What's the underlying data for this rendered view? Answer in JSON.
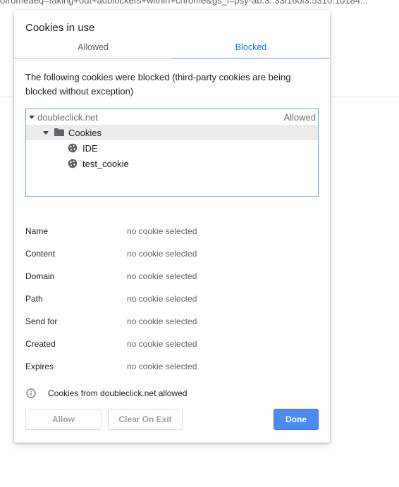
{
  "background": {
    "url_fragment": "ofromeaeq=taking+out+adblockers+within+chrome&gs_l=psy-ab.3..33i160l3.5310.10184..."
  },
  "dialog": {
    "title": "Cookies in use",
    "tabs": [
      {
        "label": "Allowed",
        "selected": false
      },
      {
        "label": "Blocked",
        "selected": true
      }
    ],
    "description": "The following cookies were blocked (third-party cookies are being blocked without exception)",
    "tree": {
      "domain": "doubleclick.net",
      "domain_status": "Allowed",
      "folder": "Cookies",
      "cookies": [
        "IDE",
        "test_cookie"
      ]
    },
    "details": [
      {
        "label": "Name",
        "value": "no cookie selected"
      },
      {
        "label": "Content",
        "value": "no cookie selected"
      },
      {
        "label": "Domain",
        "value": "no cookie selected"
      },
      {
        "label": "Path",
        "value": "no cookie selected"
      },
      {
        "label": "Send for",
        "value": "no cookie selected"
      },
      {
        "label": "Created",
        "value": "no cookie selected"
      },
      {
        "label": "Expires",
        "value": "no cookie selected"
      }
    ],
    "info_message": "Cookies from doubleclick.net allowed",
    "buttons": {
      "allow": "Allow",
      "clear_on_exit": "Clear On Exit",
      "done": "Done"
    },
    "colors": {
      "accent": "#1a73e8",
      "done_button": "#4c8af4",
      "tree_border": "#6fa0dc"
    }
  }
}
